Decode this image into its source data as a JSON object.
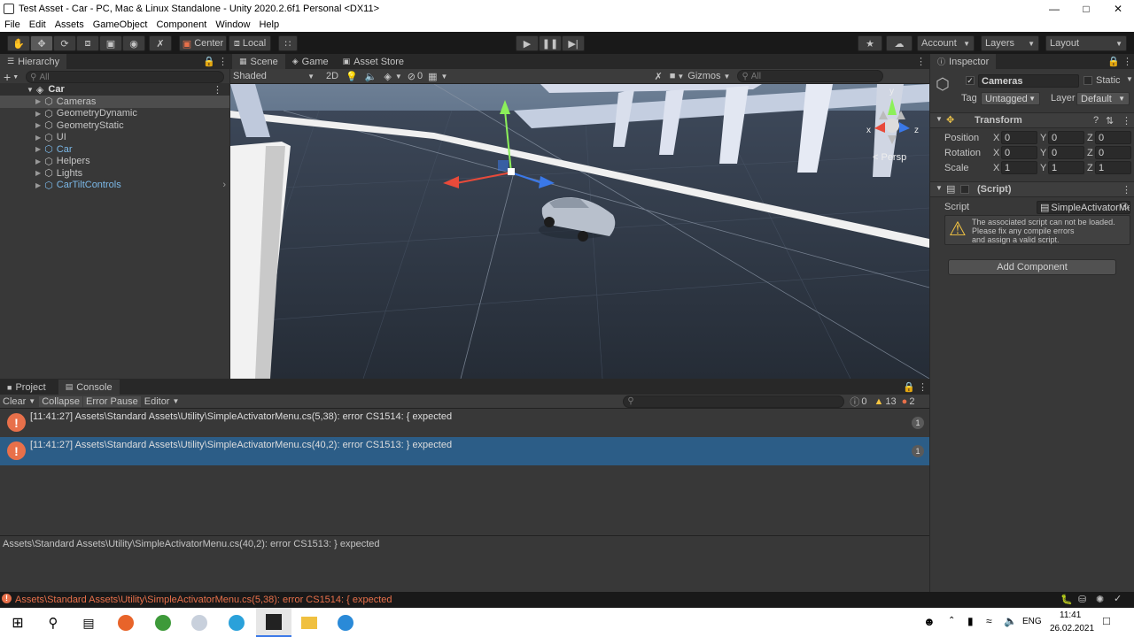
{
  "window": {
    "title": "Test Asset - Car - PC, Mac & Linux Standalone - Unity 2020.2.6f1 Personal <DX11>"
  },
  "menu": [
    "File",
    "Edit",
    "Assets",
    "GameObject",
    "Component",
    "Window",
    "Help"
  ],
  "toolbar": {
    "center_label": "Center",
    "local_label": "Local",
    "account_label": "Account",
    "layers_label": "Layers",
    "layout_label": "Layout"
  },
  "hierarchy": {
    "tab_label": "Hierarchy",
    "search_placeholder": "All",
    "root": "Car",
    "items": [
      {
        "label": "Cameras",
        "prefab": false,
        "selected": true
      },
      {
        "label": "GeometryDynamic",
        "prefab": false
      },
      {
        "label": "GeometryStatic",
        "prefab": false
      },
      {
        "label": "UI",
        "prefab": false
      },
      {
        "label": "Car",
        "prefab": true
      },
      {
        "label": "Helpers",
        "prefab": false
      },
      {
        "label": "Lights",
        "prefab": false
      },
      {
        "label": "CarTiltControls",
        "prefab": true
      }
    ]
  },
  "scene": {
    "tabs": [
      "Scene",
      "Game",
      "Asset Store"
    ],
    "shading": "Shaded",
    "mode_2d": "2D",
    "fx_count": "0",
    "gizmos_label": "Gizmos",
    "search_placeholder": "All",
    "persp_label": "< Persp",
    "axis_x": "x",
    "axis_z": "z",
    "axis_y": "y"
  },
  "console": {
    "tabs": [
      "Project",
      "Console"
    ],
    "clear_label": "Clear",
    "collapse_label": "Collapse",
    "error_pause_label": "Error Pause",
    "editor_label": "Editor",
    "info_count": "0",
    "warning_count": "13",
    "error_count": "2",
    "entries": [
      {
        "text": "[11:41:27] Assets\\Standard Assets\\Utility\\SimpleActivatorMenu.cs(5,38): error CS1514: { expected",
        "count": "1",
        "selected": false
      },
      {
        "text": "[11:41:27] Assets\\Standard Assets\\Utility\\SimpleActivatorMenu.cs(40,2): error CS1513: } expected",
        "count": "1",
        "selected": true
      }
    ],
    "detail": "Assets\\Standard Assets\\Utility\\SimpleActivatorMenu.cs(40,2): error CS1513: } expected"
  },
  "inspector": {
    "tab_label": "Inspector",
    "object_name": "Cameras",
    "static_label": "Static",
    "tag_label": "Tag",
    "tag_value": "Untagged",
    "layer_label": "Layer",
    "layer_value": "Default",
    "transform_label": "Transform",
    "position_label": "Position",
    "rotation_label": "Rotation",
    "scale_label": "Scale",
    "position": {
      "x": "0",
      "y": "0",
      "z": "0"
    },
    "rotation": {
      "x": "0",
      "y": "0",
      "z": "0"
    },
    "scale": {
      "x": "1",
      "y": "1",
      "z": "1"
    },
    "script_header": "(Script)",
    "script_label": "Script",
    "script_value": "SimpleActivatorMenu",
    "warning": "The associated script can not be loaded.\nPlease fix any compile errors\nand assign a valid script.",
    "add_component_label": "Add Component"
  },
  "statusbar": {
    "message": "Assets\\Standard Assets\\Utility\\SimpleActivatorMenu.cs(5,38): error CS1514: { expected"
  },
  "taskbar": {
    "language": "ENG",
    "time": "11:41",
    "date": "26.02.2021"
  },
  "colors": {
    "accent_blue": "#2c5d87",
    "error_red": "#e8704a",
    "prefab_blue": "#7bb8e8"
  }
}
